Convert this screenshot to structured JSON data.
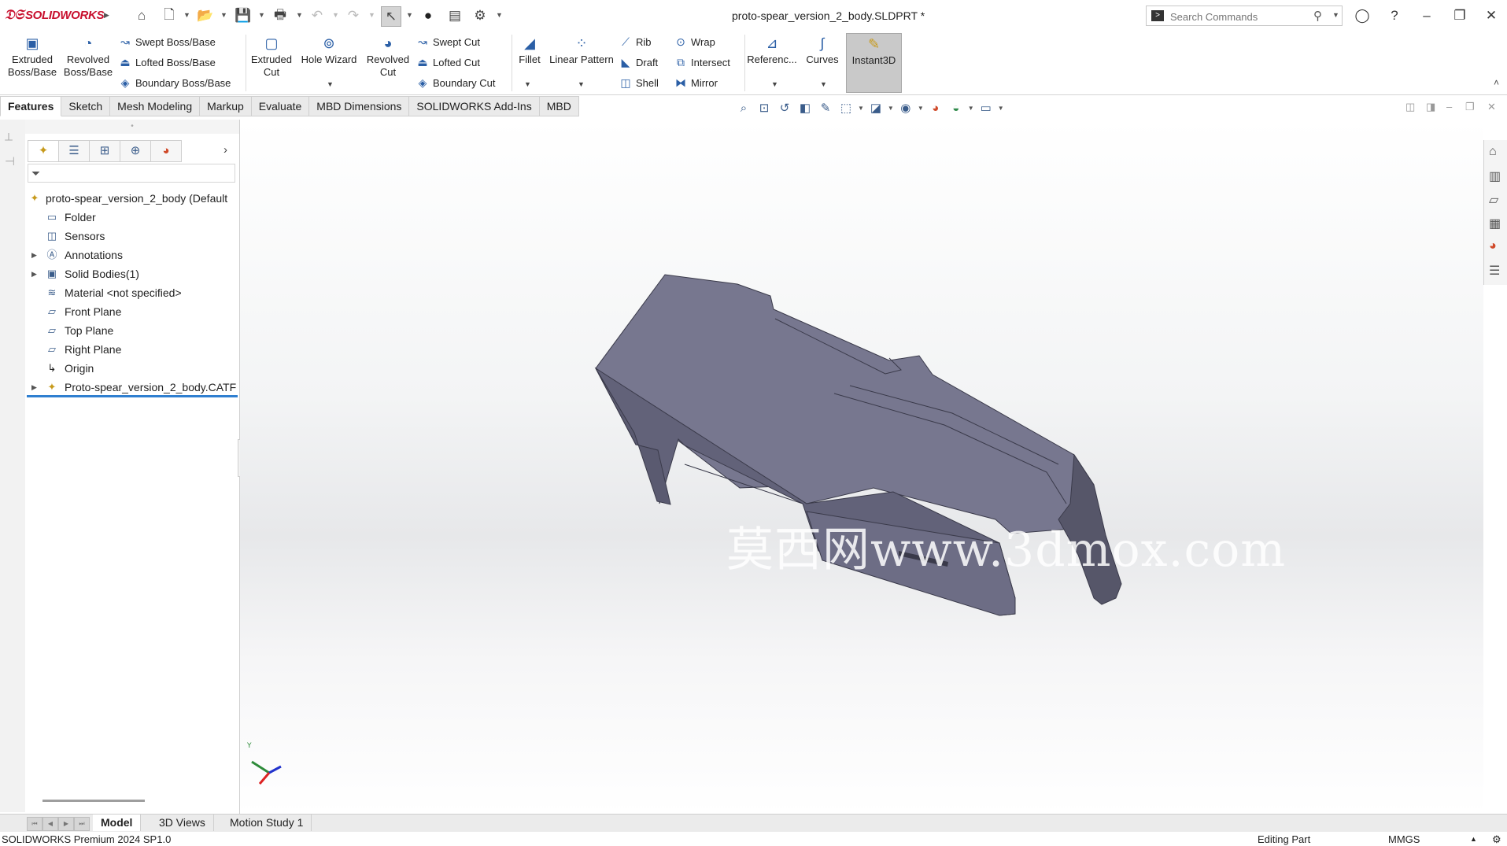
{
  "app": {
    "brand": "SOLIDWORKS",
    "title": "proto-spear_version_2_body.SLDPRT *"
  },
  "search": {
    "placeholder": "Search Commands"
  },
  "ribbon": {
    "extruded_boss": "Extruded Boss/Base",
    "revolved_boss": "Revolved Boss/Base",
    "swept_boss": "Swept Boss/Base",
    "lofted_boss": "Lofted Boss/Base",
    "boundary_boss": "Boundary Boss/Base",
    "extruded_cut": "Extruded Cut",
    "hole_wizard": "Hole Wizard",
    "revolved_cut": "Revolved Cut",
    "swept_cut": "Swept Cut",
    "lofted_cut": "Lofted Cut",
    "boundary_cut": "Boundary Cut",
    "fillet": "Fillet",
    "linear_pattern": "Linear Pattern",
    "rib": "Rib",
    "draft": "Draft",
    "shell": "Shell",
    "wrap": "Wrap",
    "intersect": "Intersect",
    "mirror": "Mirror",
    "reference": "Referenc...",
    "curves": "Curves",
    "instant3d": "Instant3D"
  },
  "tabs": [
    "Features",
    "Sketch",
    "Mesh Modeling",
    "Markup",
    "Evaluate",
    "MBD Dimensions",
    "SOLIDWORKS Add-Ins",
    "MBD"
  ],
  "tree": {
    "root": "proto-spear_version_2_body (Default",
    "items": [
      {
        "label": "Folder",
        "icon": "folder-icon",
        "expandable": false
      },
      {
        "label": "Sensors",
        "icon": "sensors-icon",
        "expandable": false
      },
      {
        "label": "Annotations",
        "icon": "annotations-icon",
        "expandable": true
      },
      {
        "label": "Solid Bodies(1)",
        "icon": "solid-bodies-icon",
        "expandable": true
      },
      {
        "label": "Material <not specified>",
        "icon": "material-icon",
        "expandable": false
      },
      {
        "label": "Front Plane",
        "icon": "plane-icon",
        "expandable": false
      },
      {
        "label": "Top Plane",
        "icon": "plane-icon",
        "expandable": false
      },
      {
        "label": "Right Plane",
        "icon": "plane-icon",
        "expandable": false
      },
      {
        "label": "Origin",
        "icon": "origin-icon",
        "expandable": false
      },
      {
        "label": "Proto-spear_version_2_body.CATF",
        "icon": "imported-body-icon",
        "expandable": true
      }
    ]
  },
  "viewport": {
    "watermark": "莫西网www.3dmox.com",
    "part_color": "#77778f"
  },
  "bottom_tabs": [
    "Model",
    "3D Views",
    "Motion Study 1"
  ],
  "status": {
    "product": "SOLIDWORKS Premium 2024 SP1.0",
    "mode": "Editing Part",
    "units": "MMGS"
  }
}
